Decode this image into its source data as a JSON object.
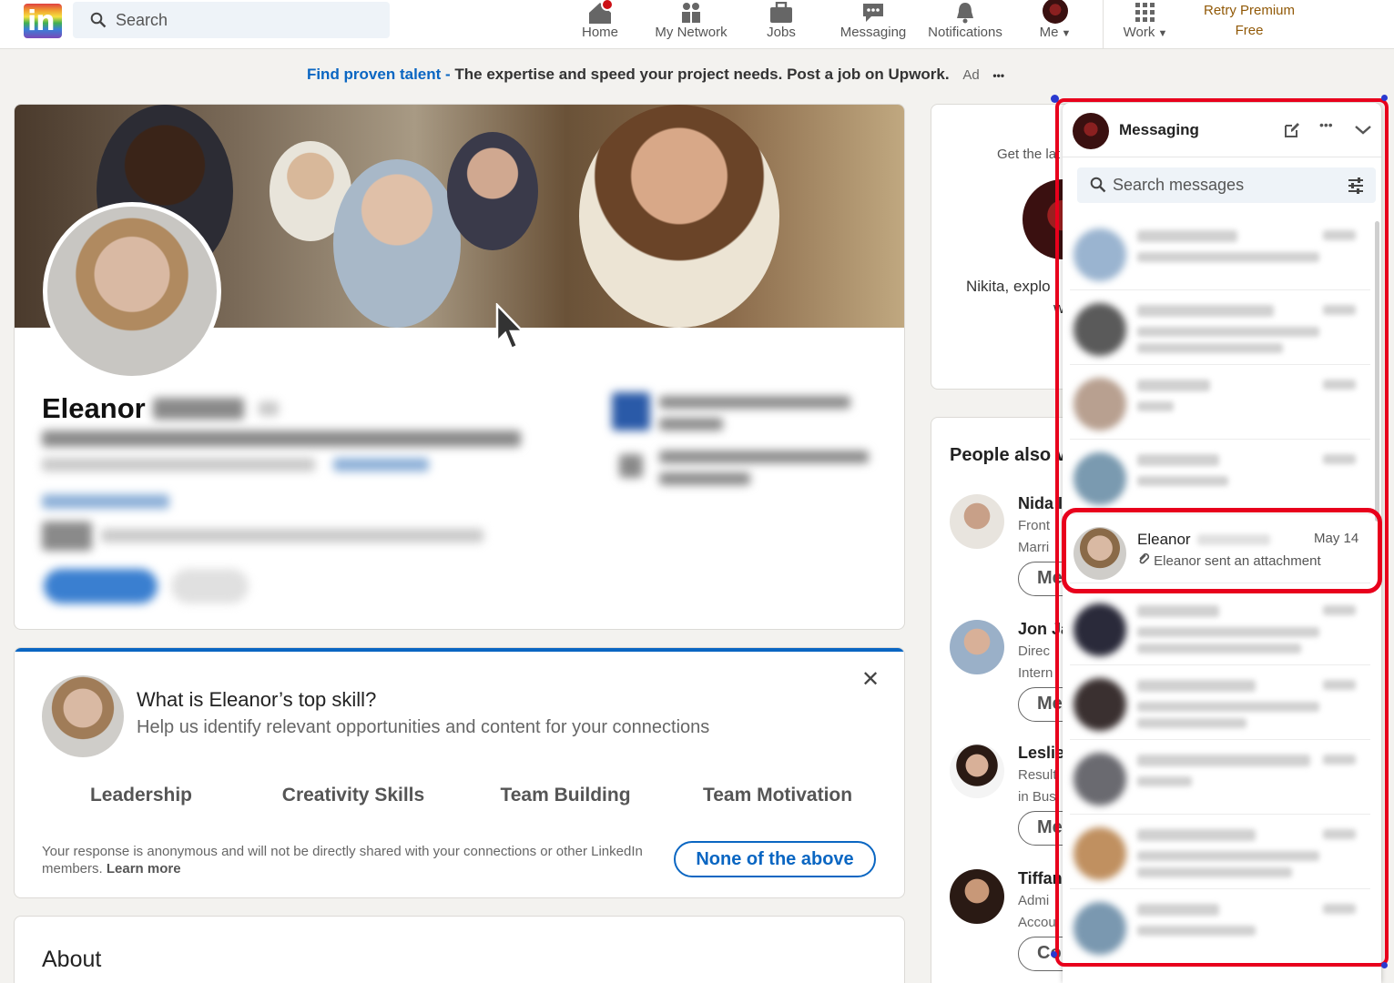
{
  "nav": {
    "search_placeholder": "Search",
    "items": [
      {
        "label": "Home",
        "icon": "home-icon"
      },
      {
        "label": "My Network",
        "icon": "network-icon"
      },
      {
        "label": "Jobs",
        "icon": "briefcase-icon"
      },
      {
        "label": "Messaging",
        "icon": "messaging-icon"
      },
      {
        "label": "Notifications",
        "icon": "bell-icon"
      },
      {
        "label": "Me",
        "icon": "avatar"
      },
      {
        "label": "Work",
        "icon": "grid-icon"
      }
    ],
    "premium_line1": "Retry Premium",
    "premium_line2": "Free"
  },
  "ad": {
    "link": "Find proven talent -",
    "text": " The expertise and speed your project needs. Post a job on Upwork.",
    "label": "Ad",
    "more": "•••"
  },
  "profile": {
    "name": "Eleanor"
  },
  "skill_card": {
    "question": "What is Eleanor’s top skill?",
    "subtitle": "Help us identify relevant opportunities and content for your connections",
    "options": [
      "Leadership",
      "Creativity Skills",
      "Team Building",
      "Team Motivation"
    ],
    "disclaimer": "Your response is anonymous and will not be directly shared with your connections or other LinkedIn members.",
    "learn_more": "Learn more",
    "none_button": "None of the above",
    "close": "✕"
  },
  "about": {
    "title": "About"
  },
  "sidebar": {
    "get_the_latest": "Get the lat",
    "nikita_line": "Nikita, explo",
    "nikita_line2": "wi",
    "people_title": "People also v",
    "people": [
      {
        "name": "Nida I",
        "line1": "Front",
        "line2": "Marri",
        "btn": "Me"
      },
      {
        "name": "Jon Ja",
        "line1": "Direc",
        "line2": "Intern",
        "btn": "Me"
      },
      {
        "name": "Leslie",
        "line1": "Result",
        "line2": "in Busi",
        "btn": "Me"
      },
      {
        "name": "Tiffan",
        "line1": "Admi",
        "line2": "Accou",
        "btn": "Co"
      }
    ]
  },
  "messaging": {
    "title": "Messaging",
    "search_placeholder": "Search messages",
    "active": {
      "name": "Eleanor",
      "date": "May 14",
      "preview": "Eleanor sent an attachment"
    }
  }
}
